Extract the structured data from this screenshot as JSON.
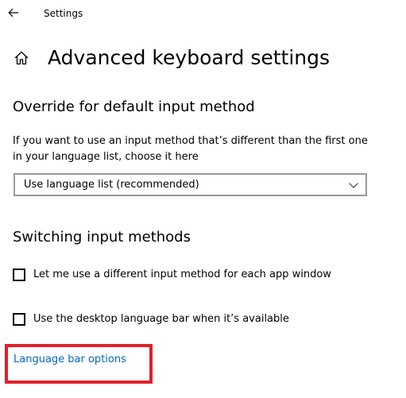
{
  "window": {
    "title": "Settings",
    "back_icon": "arrow-left-icon"
  },
  "header": {
    "home_icon": "home-icon",
    "title": "Advanced keyboard settings"
  },
  "override_section": {
    "title": "Override for default input method",
    "description": "If you want to use an input method that’s different than the first one in your language list, choose it here",
    "dropdown": {
      "selected": "Use language list (recommended)",
      "chevron_icon": "chevron-down-icon"
    }
  },
  "switching_section": {
    "title": "Switching input methods",
    "checkboxes": [
      {
        "label": "Let me use a different input method for each app window",
        "checked": false
      },
      {
        "label": "Use the desktop language bar when it’s available",
        "checked": false
      }
    ],
    "link": "Language bar options"
  },
  "annotation": {
    "highlight_color": "#e0202a"
  },
  "colors": {
    "link": "#0067c0",
    "text": "#000000",
    "background": "#ffffff"
  }
}
